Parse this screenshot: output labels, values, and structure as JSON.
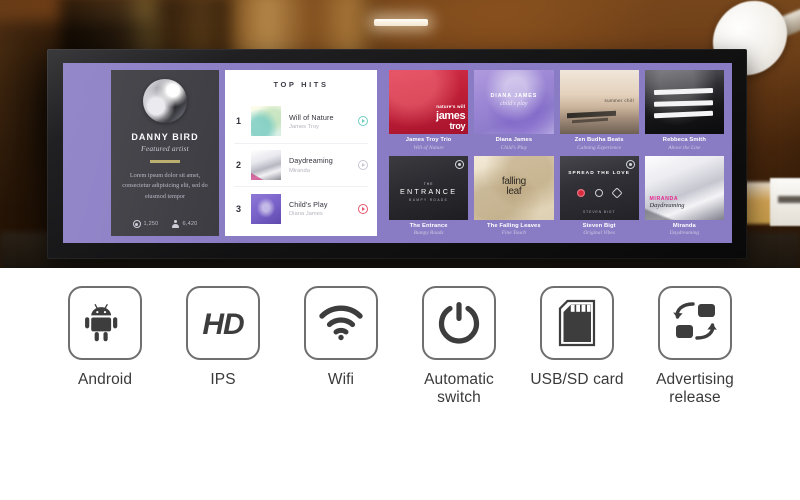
{
  "display": {
    "artist_card": {
      "name": "DANNY BIRD",
      "role": "Featured artist",
      "bio": "Lorem ipsum dolor sit amet, consectetur adipisicing elit, sed do eiusmod tempor",
      "stats": [
        {
          "icon": "play-count-icon",
          "value": "1,250"
        },
        {
          "icon": "followers-icon",
          "value": "6,420"
        }
      ]
    },
    "top_hits": {
      "title": "TOP HITS",
      "tracks": [
        {
          "rank": "1",
          "song": "Will of Nature",
          "artist": "James Troy",
          "play_color": "#6ecfc0"
        },
        {
          "rank": "2",
          "song": "Daydreaming",
          "artist": "Miranda",
          "play_color": "#c9c6d2"
        },
        {
          "rank": "3",
          "song": "Child's Play",
          "artist": "Diana James",
          "play_color": "#e8566f"
        }
      ]
    },
    "albums": [
      {
        "title": "James Troy Trio",
        "subtitle": "Will of Nature",
        "cover": {
          "line1": "nature's will",
          "line2": "james",
          "line3": "troy"
        }
      },
      {
        "title": "Diana James",
        "subtitle": "Child's Play",
        "cover": {
          "line1": "DIANA JAMES",
          "line2": "child's play"
        }
      },
      {
        "title": "Zen Budha Beats",
        "subtitle": "Calming Experience",
        "cover": {
          "line1": "summer chill"
        }
      },
      {
        "title": "Rebbeca Smith",
        "subtitle": "Above the Line",
        "cover": {}
      },
      {
        "title": "The Entrance",
        "subtitle": "Bumpy Roads",
        "cover": {
          "line0": "THE",
          "line1": "ENTRANCE",
          "line2": "BUMPY ROADS"
        }
      },
      {
        "title": "The Falling Leaves",
        "subtitle": "Fine Touch",
        "cover": {
          "line1": "falling",
          "line2": "leaf"
        }
      },
      {
        "title": "Steven Bigt",
        "subtitle": "Original Vibes",
        "cover": {
          "line1": "SPREAD THE LOVE",
          "line2": "STEVEN BIGT"
        }
      },
      {
        "title": "Miranda",
        "subtitle": "Daydreaming",
        "cover": {
          "line1": "MIRANDA",
          "line2": "Daydreaming"
        }
      }
    ]
  },
  "features": [
    {
      "icon": "android-icon",
      "label": "Android"
    },
    {
      "icon": "hd-icon",
      "label": "IPS"
    },
    {
      "icon": "wifi-icon",
      "label": "Wifi"
    },
    {
      "icon": "power-icon",
      "label": "Automatic switch"
    },
    {
      "icon": "sd-card-icon",
      "label": "USB/SD card"
    },
    {
      "icon": "sync-arrows-icon",
      "label": "Advertising release"
    }
  ]
}
